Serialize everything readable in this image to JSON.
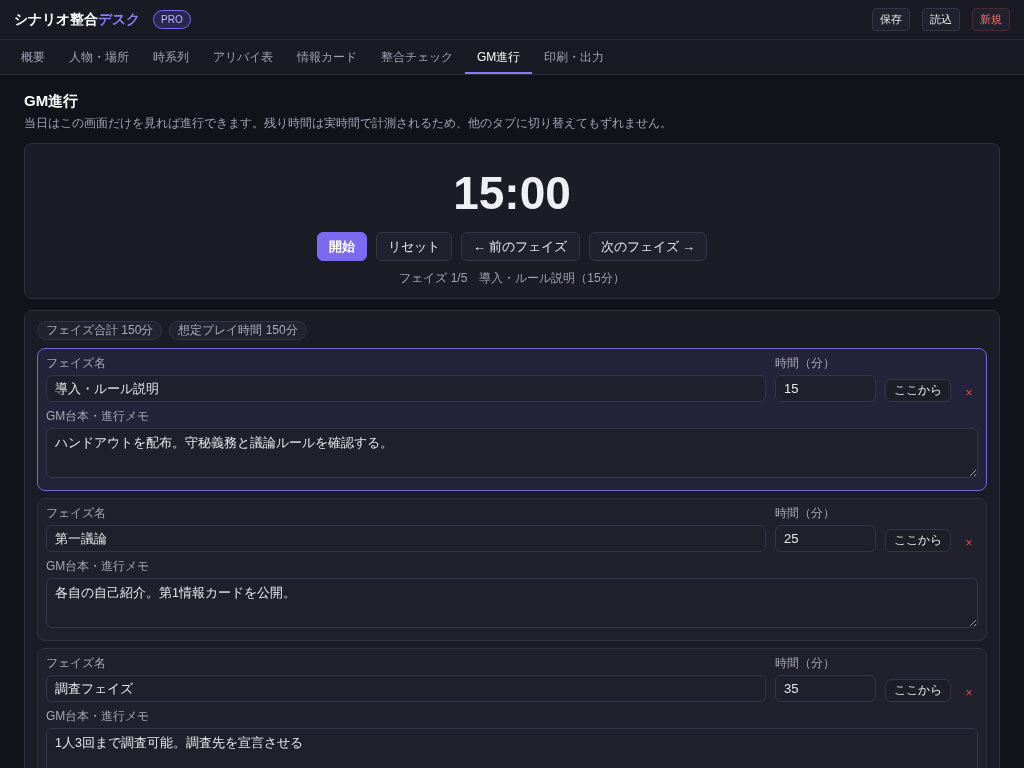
{
  "app": {
    "title": "シナリオ整合",
    "title_accent": "デスク",
    "badge": "PRO"
  },
  "header_buttons": [
    {
      "label": "保存",
      "kind": "normal"
    },
    {
      "label": "読込",
      "kind": "normal"
    },
    {
      "label": "新規",
      "kind": "danger"
    }
  ],
  "tabs": [
    {
      "label": "概要",
      "selected": false
    },
    {
      "label": "人物・場所",
      "selected": false
    },
    {
      "label": "時系列",
      "selected": false
    },
    {
      "label": "アリバイ表",
      "selected": false
    },
    {
      "label": "情報カード",
      "selected": false
    },
    {
      "label": "整合チェック",
      "selected": false
    },
    {
      "label": "GM進行",
      "selected": true
    },
    {
      "label": "印刷・出力",
      "selected": false
    }
  ],
  "page": {
    "heading": "GM進行",
    "description": "当日はこの画面だけを見れば進行できます。残り時間は実時間で計測されるため、他のタブに切り替えてもずれません。"
  },
  "timer": {
    "display": "15:00",
    "buttons": [
      {
        "label": "開始",
        "kind": "primary"
      },
      {
        "label": "リセット",
        "kind": "normal"
      },
      {
        "label": "← 前のフェイズ",
        "kind": "normal"
      },
      {
        "label": "次のフェイズ →",
        "kind": "normal"
      }
    ],
    "status": "フェイズ 1/5　導入・ルール説明（15分）"
  },
  "summary_chips": [
    "フェイズ合計 150分",
    "想定プレイ時間 150分"
  ],
  "phases": [
    {
      "selected": true,
      "name_label": "フェイズ名",
      "name": "導入・ルール説明",
      "minutes_label": "時間（分）",
      "minutes": "15",
      "start_button": "ここから",
      "delete_button": "×",
      "memo_label": "GM台本・進行メモ",
      "memo": "ハンドアウトを配布。守秘義務と議論ルールを確認する。"
    },
    {
      "selected": false,
      "name_label": "フェイズ名",
      "name": "第一議論",
      "minutes_label": "時間（分）",
      "minutes": "25",
      "start_button": "ここから",
      "delete_button": "×",
      "memo_label": "GM台本・進行メモ",
      "memo": "各自の自己紹介。第1情報カードを公開。"
    },
    {
      "selected": false,
      "name_label": "フェイズ名",
      "name": "調査フェイズ",
      "minutes_label": "時間（分）",
      "minutes": "35",
      "start_button": "ここから",
      "delete_button": "×",
      "memo_label": "GM台本・進行メモ",
      "memo": "1人3回まで調査可能。調査先を宣言させる"
    }
  ]
}
